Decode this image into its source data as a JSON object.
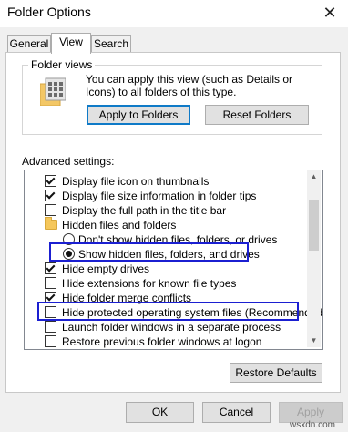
{
  "window": {
    "title": "Folder Options",
    "close_glyph": "✕"
  },
  "tabs": [
    {
      "label": "General"
    },
    {
      "label": "View"
    },
    {
      "label": "Search"
    }
  ],
  "folder_views": {
    "group_label": "Folder views",
    "description": "You can apply this view (such as Details or Icons) to all folders of this type.",
    "apply_label": "Apply to Folders",
    "reset_label": "Reset Folders"
  },
  "advanced": {
    "label": "Advanced settings:",
    "items": [
      {
        "type": "checkbox",
        "checked": true,
        "label": "Display file icon on thumbnails"
      },
      {
        "type": "checkbox",
        "checked": true,
        "label": "Display file size information in folder tips"
      },
      {
        "type": "checkbox",
        "checked": false,
        "label": "Display the full path in the title bar"
      },
      {
        "type": "folder",
        "label": "Hidden files and folders"
      },
      {
        "type": "radio",
        "checked": false,
        "label": "Don't show hidden files, folders, or drives"
      },
      {
        "type": "radio",
        "checked": true,
        "label": "Show hidden files, folders, and drives"
      },
      {
        "type": "checkbox",
        "checked": true,
        "label": "Hide empty drives"
      },
      {
        "type": "checkbox",
        "checked": false,
        "label": "Hide extensions for known file types"
      },
      {
        "type": "checkbox",
        "checked": true,
        "label": "Hide folder merge conflicts"
      },
      {
        "type": "checkbox",
        "checked": false,
        "label": "Hide protected operating system files (Recommended)"
      },
      {
        "type": "checkbox",
        "checked": false,
        "label": "Launch folder windows in a separate process"
      },
      {
        "type": "checkbox",
        "checked": false,
        "label": "Restore previous folder windows at logon"
      }
    ],
    "restore_label": "Restore Defaults"
  },
  "footer": {
    "ok": "OK",
    "cancel": "Cancel",
    "apply": "Apply"
  },
  "watermark": "wsxdn.com",
  "colors": {
    "highlight_box": "#1b1fd1",
    "focus_border": "#0f7ac7",
    "disabled_text": "#a0a0a0"
  }
}
